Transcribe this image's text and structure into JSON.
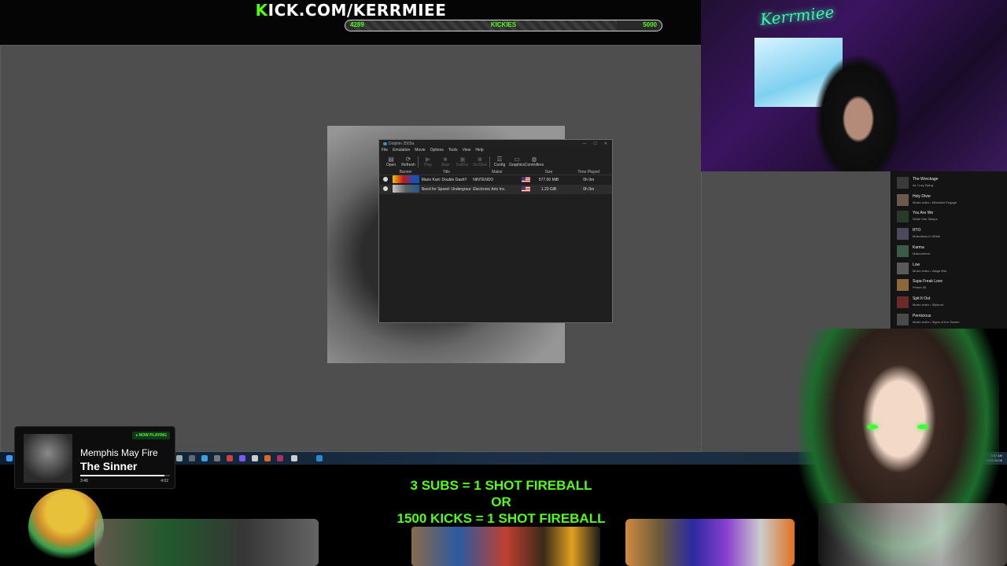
{
  "header": {
    "url_k": "K",
    "url_rest": "ICK.COM/KERRMIEE",
    "progress_min": "4289",
    "progress_label": "KICKIES",
    "progress_max": "5000",
    "progress_fraction": 0.858
  },
  "dolphin": {
    "title": "Dolphin 2503a",
    "window_buttons": [
      "—",
      "☐",
      "✕"
    ],
    "menu": [
      "File",
      "Emulation",
      "Movie",
      "Options",
      "Tools",
      "View",
      "Help"
    ],
    "toolbar": [
      {
        "label": "Open",
        "icon": "folder-icon",
        "glyph": "▤",
        "enabled": true
      },
      {
        "label": "Refresh",
        "icon": "refresh-icon",
        "glyph": "⟳",
        "enabled": true
      },
      {
        "label": "Play",
        "icon": "play-icon",
        "glyph": "▶",
        "enabled": false
      },
      {
        "label": "Stop",
        "icon": "stop-icon",
        "glyph": "■",
        "enabled": false
      },
      {
        "label": "FullScr",
        "icon": "fullscreen-icon",
        "glyph": "▣",
        "enabled": false
      },
      {
        "label": "ScrShot",
        "icon": "camera-icon",
        "glyph": "◙",
        "enabled": false
      },
      {
        "label": "Config",
        "icon": "config-icon",
        "glyph": "☰",
        "enabled": true
      },
      {
        "label": "Graphics",
        "icon": "graphics-icon",
        "glyph": "▭",
        "enabled": true
      },
      {
        "label": "Controllers",
        "icon": "gamepad-icon",
        "glyph": "◍",
        "enabled": true
      }
    ],
    "columns": {
      "banner": "Banner",
      "title": "Title",
      "maker": "Maker",
      "size": "Size",
      "time": "Time Played"
    },
    "games": [
      {
        "title": "Mario Kart: Double Dash!!",
        "maker": "NINTENDO",
        "size": "577.00 MiB",
        "time": "0h 0m"
      },
      {
        "title": "Need for Speed: Underground 2",
        "maker": "Electronic Arts Inc.",
        "size": "1.23 GiB",
        "time": "0h 0m"
      }
    ]
  },
  "webcam": {
    "neon_sign": "Kerrmiee"
  },
  "playlist": [
    {
      "title": "The Wreckage",
      "sub": "As I Lay Dying",
      "thumb": "#3a3a3a"
    },
    {
      "title": "Holy Diver",
      "sub": "Music video • Killswitch Engage",
      "thumb": "#6b5a4a"
    },
    {
      "title": "You Are We",
      "sub": "While She Sleeps",
      "thumb": "#2a3a2a"
    },
    {
      "title": "RTO",
      "sub": "Motionless In White",
      "thumb": "#4a4a5a"
    },
    {
      "title": "Karma",
      "sub": "Malevolence",
      "thumb": "#3a5a4a"
    },
    {
      "title": "Low",
      "sub": "Music video • Wage War",
      "thumb": "#5a5a5a"
    },
    {
      "title": "Supa Freak Love",
      "sub": "Primer 55",
      "thumb": "#8a6a3a"
    },
    {
      "title": "Spit It Out",
      "sub": "Music video • Slipknot",
      "thumb": "#6a2a2a"
    },
    {
      "title": "Pernicious",
      "sub": "Music video • Signs of the Swarm",
      "thumb": "#4a4a4a"
    }
  ],
  "taskbar": {
    "time": "3:57 AM",
    "date": "2025-04-06"
  },
  "now_playing": {
    "badge": "● NOW PLAYING",
    "artist": "Memphis May Fire",
    "song": "The Sinner",
    "elapsed": "3:48",
    "total": "4:02",
    "progress_fraction": 0.94
  },
  "promo": {
    "line1": "3 SUBS = 1 SHOT FIREBALL",
    "line2": "OR",
    "line3": "1500 KICKS = 1 SHOT FIREBALL"
  },
  "colors": {
    "kick_green": "#53fc18",
    "desktop_gray": "#4e4e4e"
  }
}
